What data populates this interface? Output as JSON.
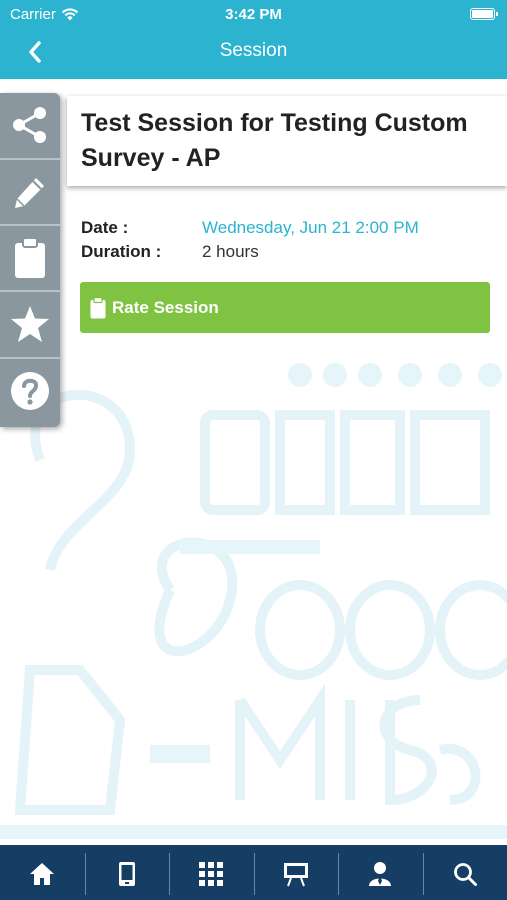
{
  "status_bar": {
    "carrier": "Carrier",
    "time": "3:42 PM"
  },
  "nav": {
    "title": "Session",
    "back_icon": "chevron-left-icon"
  },
  "sidebar": {
    "items": [
      {
        "icon": "share-icon"
      },
      {
        "icon": "pencil-icon"
      },
      {
        "icon": "clipboard-icon"
      },
      {
        "icon": "star-icon"
      },
      {
        "icon": "help-icon"
      }
    ]
  },
  "session": {
    "title": "Test Session for Testing Custom Survey - AP",
    "date_label": "Date :",
    "date_value": "Wednesday, Jun 21 2:00 PM",
    "duration_label": "Duration :",
    "duration_value": "2 hours",
    "rate_button": "Rate Session"
  },
  "tabbar": {
    "items": [
      {
        "icon": "home-icon"
      },
      {
        "icon": "mobile-icon"
      },
      {
        "icon": "grid-icon"
      },
      {
        "icon": "presentation-icon"
      },
      {
        "icon": "speaker-icon"
      },
      {
        "icon": "search-icon"
      }
    ]
  },
  "colors": {
    "header": "#2bb3cf",
    "sidebar": "#8a979f",
    "rate_button": "#80c342",
    "tabbar": "#163d64",
    "link": "#2bb3cf"
  }
}
